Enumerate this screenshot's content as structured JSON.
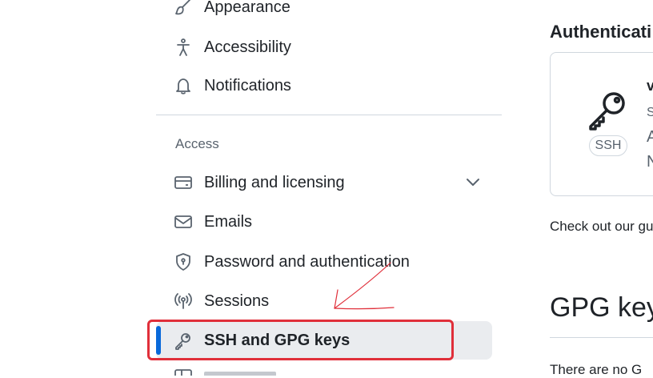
{
  "sidebar": {
    "items_top": [
      {
        "label": "Appearance",
        "icon": "paintbrush-icon"
      },
      {
        "label": "Accessibility",
        "icon": "accessibility-icon"
      },
      {
        "label": "Notifications",
        "icon": "bell-icon"
      }
    ],
    "access_section_title": "Access",
    "items_access": [
      {
        "label": "Billing and licensing",
        "icon": "credit-card-icon",
        "has_chevron": true
      },
      {
        "label": "Emails",
        "icon": "mail-icon"
      },
      {
        "label": "Password and authentication",
        "icon": "shield-lock-icon"
      },
      {
        "label": "Sessions",
        "icon": "broadcast-icon"
      },
      {
        "label": "SSH and GPG keys",
        "icon": "key-icon",
        "active": true
      }
    ]
  },
  "main": {
    "auth_heading": "Authenticati",
    "card": {
      "badge": "SSH",
      "frag_title": "v",
      "frag_line1": "S",
      "frag_line2": "A",
      "frag_line3": "N"
    },
    "check_text": "Check out our gu",
    "gpg_heading": "GPG key",
    "gpg_text": "There are no G"
  },
  "colors": {
    "accent": "#0969da",
    "annotation": "#e02f3a"
  }
}
